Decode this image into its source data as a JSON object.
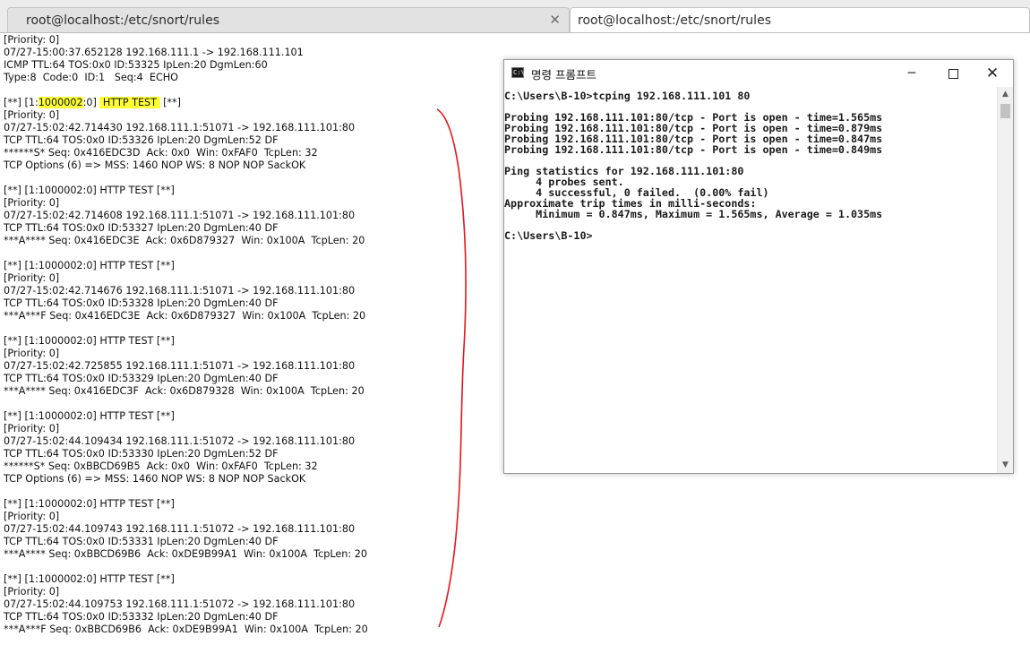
{
  "tabs": [
    {
      "label": "root@localhost:/etc/snort/rules",
      "active": false
    },
    {
      "label": "root@localhost:/etc/snort/rules",
      "active": true
    }
  ],
  "terminal": {
    "lines": [
      "[Priority: 0]",
      "07/27-15:00:37.652128 192.168.111.1 -> 192.168.111.101",
      "ICMP TTL:64 TOS:0x0 ID:53325 IpLen:20 DgmLen:60",
      "Type:8  Code:0  ID:1   Seq:4  ECHO",
      "",
      "[**] [1:1000002:0] HTTP TEST [**]",
      "[Priority: 0]",
      "07/27-15:02:42.714430 192.168.111.1:51071 -> 192.168.111.101:80",
      "TCP TTL:64 TOS:0x0 ID:53326 IpLen:20 DgmLen:52 DF",
      "******S* Seq: 0x416EDC3D  Ack: 0x0  Win: 0xFAF0  TcpLen: 32",
      "TCP Options (6) => MSS: 1460 NOP WS: 8 NOP NOP SackOK",
      "",
      "[**] [1:1000002:0] HTTP TEST [**]",
      "[Priority: 0]",
      "07/27-15:02:42.714608 192.168.111.1:51071 -> 192.168.111.101:80",
      "TCP TTL:64 TOS:0x0 ID:53327 IpLen:20 DgmLen:40 DF",
      "***A**** Seq: 0x416EDC3E  Ack: 0x6D879327  Win: 0x100A  TcpLen: 20",
      "",
      "[**] [1:1000002:0] HTTP TEST [**]",
      "[Priority: 0]",
      "07/27-15:02:42.714676 192.168.111.1:51071 -> 192.168.111.101:80",
      "TCP TTL:64 TOS:0x0 ID:53328 IpLen:20 DgmLen:40 DF",
      "***A***F Seq: 0x416EDC3E  Ack: 0x6D879327  Win: 0x100A  TcpLen: 20",
      "",
      "[**] [1:1000002:0] HTTP TEST [**]",
      "[Priority: 0]",
      "07/27-15:02:42.725855 192.168.111.1:51071 -> 192.168.111.101:80",
      "TCP TTL:64 TOS:0x0 ID:53329 IpLen:20 DgmLen:40 DF",
      "***A**** Seq: 0x416EDC3F  Ack: 0x6D879328  Win: 0x100A  TcpLen: 20",
      "",
      "[**] [1:1000002:0] HTTP TEST [**]",
      "[Priority: 0]",
      "07/27-15:02:44.109434 192.168.111.1:51072 -> 192.168.111.101:80",
      "TCP TTL:64 TOS:0x0 ID:53330 IpLen:20 DgmLen:52 DF",
      "******S* Seq: 0xBBCD69B5  Ack: 0x0  Win: 0xFAF0  TcpLen: 32",
      "TCP Options (6) => MSS: 1460 NOP WS: 8 NOP NOP SackOK",
      "",
      "[**] [1:1000002:0] HTTP TEST [**]",
      "[Priority: 0]",
      "07/27-15:02:44.109743 192.168.111.1:51072 -> 192.168.111.101:80",
      "TCP TTL:64 TOS:0x0 ID:53331 IpLen:20 DgmLen:40 DF",
      "***A**** Seq: 0xBBCD69B6  Ack: 0xDE9B99A1  Win: 0x100A  TcpLen: 20",
      "",
      "[**] [1:1000002:0] HTTP TEST [**]",
      "[Priority: 0]",
      "07/27-15:02:44.109753 192.168.111.1:51072 -> 192.168.111.101:80",
      "TCP TTL:64 TOS:0x0 ID:53332 IpLen:20 DgmLen:40 DF",
      "***A***F Seq: 0xBBCD69B6  Ack: 0xDE9B99A1  Win: 0x100A  TcpLen: 20"
    ],
    "highlight": {
      "prefix": "[**] [1:",
      "sid": "1000002",
      "middle": ":0] ",
      "msg": "HTTP TEST",
      "suffix": " [**]"
    }
  },
  "cmd_window": {
    "title": "명령 프롬프트",
    "lines": [
      "C:\\Users\\B-10>tcping 192.168.111.101 80",
      "",
      "Probing 192.168.111.101:80/tcp - Port is open - time=1.565ms",
      "Probing 192.168.111.101:80/tcp - Port is open - time=0.879ms",
      "Probing 192.168.111.101:80/tcp - Port is open - time=0.847ms",
      "Probing 192.168.111.101:80/tcp - Port is open - time=0.849ms",
      "",
      "Ping statistics for 192.168.111.101:80",
      "     4 probes sent.",
      "     4 successful, 0 failed.  (0.00% fail)",
      "Approximate trip times in milli-seconds:",
      "     Minimum = 0.847ms, Maximum = 1.565ms, Average = 1.035ms",
      "",
      "C:\\Users\\B-10>"
    ],
    "buttons": {
      "minimize": "─",
      "close": "✕"
    },
    "scroll": {
      "up": "▲",
      "down": "▼"
    }
  },
  "annotation": {
    "color": "#e8141b"
  }
}
